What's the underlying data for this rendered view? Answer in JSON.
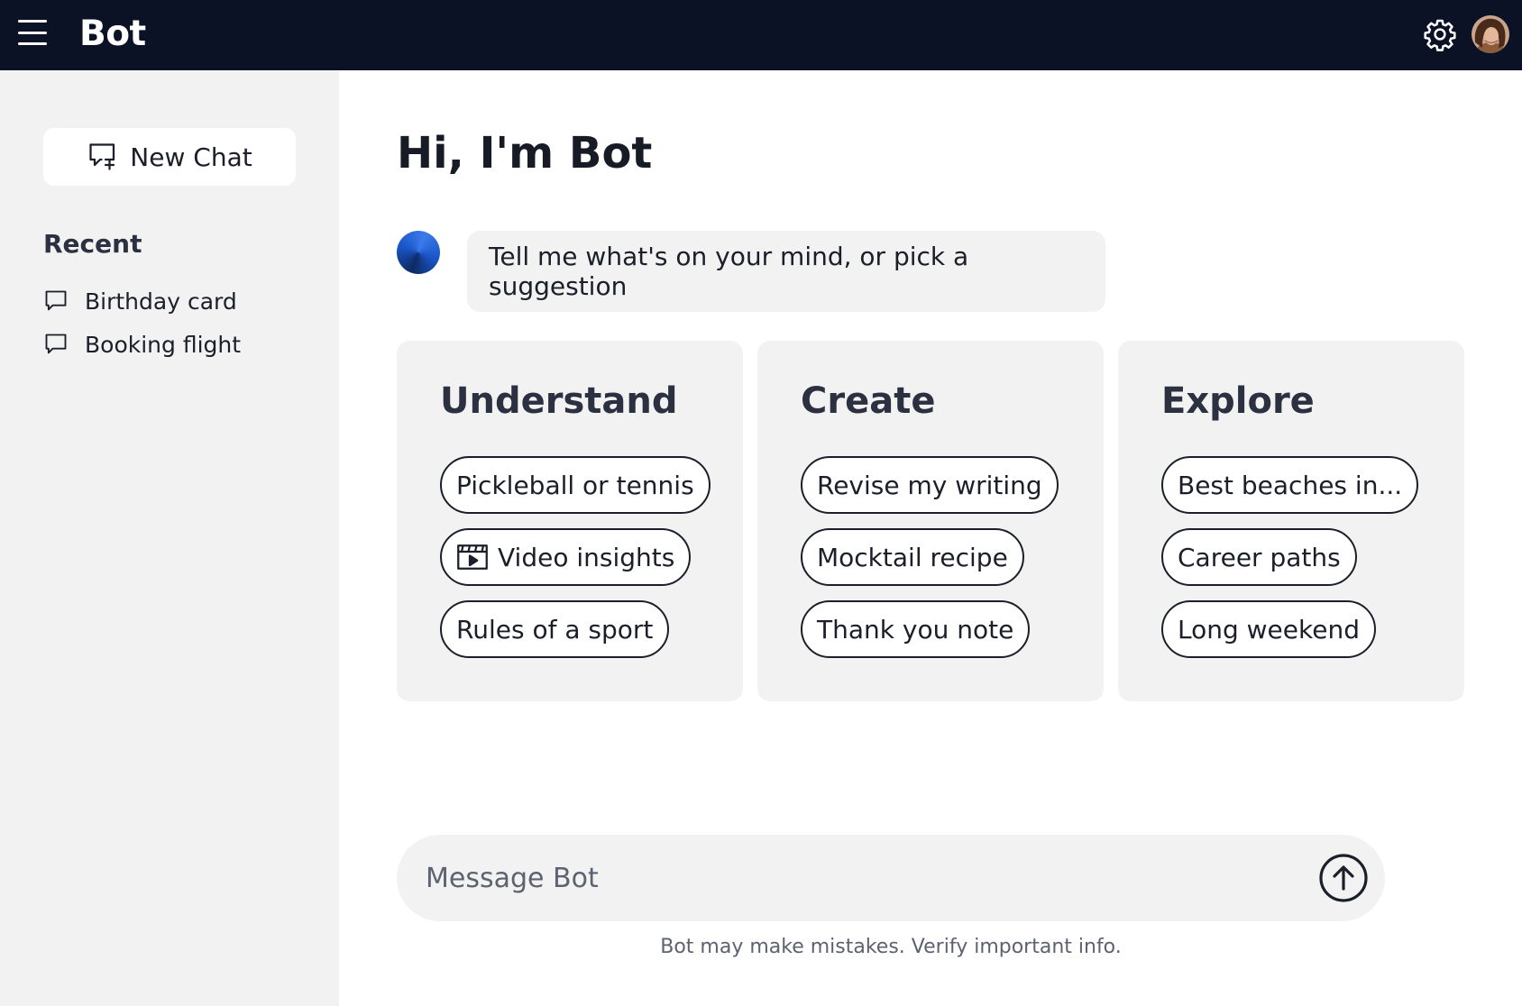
{
  "header": {
    "brand": "Bot",
    "menu_icon": "hamburger-icon",
    "settings_icon": "gear-icon",
    "avatar": "user-avatar"
  },
  "sidebar": {
    "new_chat_label": "New Chat",
    "new_chat_icon": "chat-plus-icon",
    "recent_label": "Recent",
    "recent_items": [
      {
        "label": "Birthday card",
        "icon": "chat-bubble-icon"
      },
      {
        "label": "Booking flight",
        "icon": "chat-bubble-icon"
      }
    ]
  },
  "main": {
    "greeting": "Hi, I'm Bot",
    "bot_message": "Tell me what's on your mind, or pick a suggestion",
    "cards": [
      {
        "title": "Understand",
        "chips": [
          {
            "label": "Pickleball or tennis"
          },
          {
            "label": "Video insights",
            "icon": "video-icon"
          },
          {
            "label": "Rules of a sport"
          }
        ]
      },
      {
        "title": "Create",
        "chips": [
          {
            "label": "Revise my writing"
          },
          {
            "label": "Mocktail recipe"
          },
          {
            "label": "Thank you note"
          }
        ]
      },
      {
        "title": "Explore",
        "chips": [
          {
            "label": "Best beaches in..."
          },
          {
            "label": "Career paths"
          },
          {
            "label": "Long weekend"
          }
        ]
      }
    ],
    "composer": {
      "placeholder": "Message Bot",
      "value": "",
      "send_icon": "arrow-up-circle-icon"
    },
    "disclaimer": "Bot may make mistakes. Verify important info."
  },
  "colors": {
    "topbar": "#0b1226",
    "panel": "#f2f2f2",
    "text": "#1b1f2a",
    "muted": "#5c6270"
  }
}
